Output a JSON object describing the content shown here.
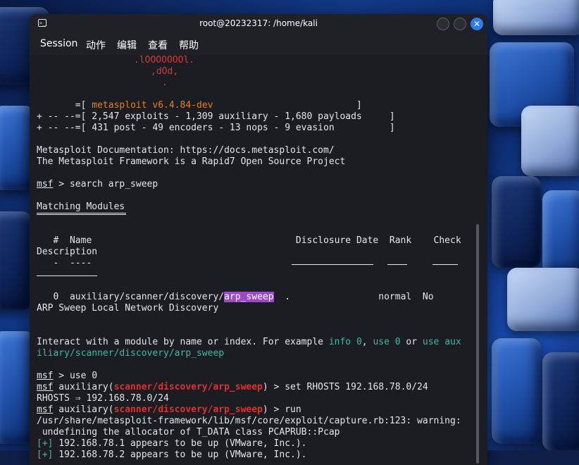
{
  "window": {
    "title": "root@20232317: /home/kali",
    "close_glyph": "✕"
  },
  "menu": [
    "Session",
    "动作",
    "编辑",
    "查看",
    "帮助"
  ],
  "terminal": {
    "art1": ".lOOOOOOOl.",
    "art2": ",dOd,",
    "art3": ".",
    "banner1_pre": "       =[ ",
    "banner1_version": "metasploit v6.4.84-dev",
    "banner1_post": "                          ]",
    "banner2": "+ -- --=[ 2,547 exploits - 1,309 auxiliary - 1,680 payloads     ]",
    "banner3": "+ -- --=[ 431 post - 49 encoders - 13 nops - 9 evasion          ]",
    "doc_line": "Metasploit Documentation: https://docs.metasploit.com/",
    "framework_line": "The Metasploit Framework is a Rapid7 Open Source Project",
    "prompt": "msf",
    "cmd_search": " > search arp_sweep",
    "matching": "Matching Modules",
    "col_header": "   #  Name                                     Disclosure Date  Rank    Check",
    "col_desc": "Description",
    "sub_header": "   -  ----",
    "row_pre": "   0  auxiliary/scanner/discovery/",
    "row_hl": "arp_sweep",
    "row_post": "  .                normal  No",
    "row_desc": "ARP Sweep Local Network Discovery",
    "interact_pre": "Interact with a module by name or index. For example ",
    "interact_info": "info 0",
    "interact_mid": ", ",
    "interact_use": "use 0",
    "interact_or": " or ",
    "interact_useaux": "use aux",
    "interact_line2": "iliary/scanner/discovery/arp_sweep",
    "cmd_use": " > use 0",
    "aux_prefix": " auxiliary(",
    "module_path": "scanner/discovery/arp_sweep",
    "cmd_set": ") > set RHOSTS 192.168.78.0/24",
    "rhosts_result": "RHOSTS ⇒ 192.168.78.0/24",
    "cmd_run": ") > run",
    "warning1": "/usr/share/metasploit-framework/lib/msf/core/exploit/capture.rb:123: warning:",
    "warning2": " undefining the allocator of T_DATA class PCAPRUB::Pcap",
    "plus": "[+]",
    "up1": " 192.168.78.1 appears to be up (VMware, Inc.).",
    "up2": " 192.168.78.2 appears to be up (VMware, Inc.)."
  },
  "colors": {
    "terminal_bg": "#1b1d22",
    "text": "#e6e6e6",
    "banner_red": "#d9383a",
    "version_orange": "#e8801a",
    "hint_teal": "#3fb8a7",
    "highlight_purple": "#9b48c9",
    "accent_blue": "#2d7cf0"
  }
}
